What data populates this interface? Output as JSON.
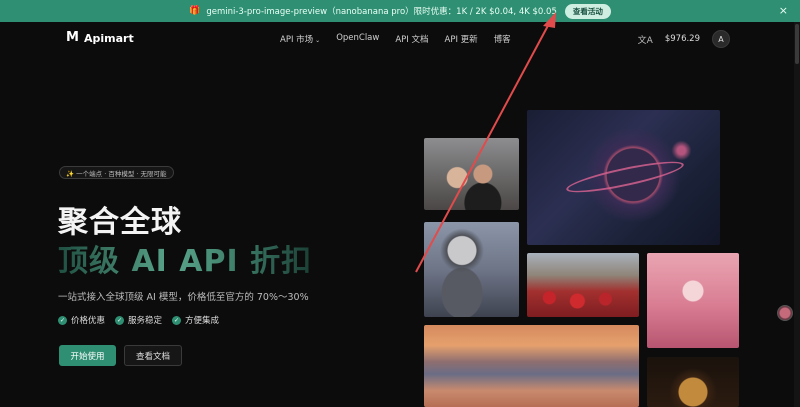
{
  "promo": {
    "icon": "gift-icon",
    "text": "gemini-3-pro-image-preview（nanobanana pro）限时优惠：1K / 2K $0.04,   4K $0.05",
    "cta": "查看活动",
    "close": "×"
  },
  "brand": {
    "name": "Apimart",
    "logo_glyph": "M"
  },
  "nav": {
    "items": [
      {
        "label": "API 市场",
        "caret": "⌄"
      },
      {
        "label": "OpenClaw"
      },
      {
        "label": "API 文档"
      },
      {
        "label": "API 更新"
      },
      {
        "label": "博客"
      }
    ]
  },
  "header_right": {
    "translate_icon": "文A",
    "balance": "$976.29",
    "avatar": "A"
  },
  "hero": {
    "badge": "✨ 一个端点 · 百种模型 · 无限可能",
    "title_line1": "聚合全球",
    "title_line2": "顶级 AI API 折扣",
    "subtitle": "一站式接入全球顶级 AI 模型，价格低至官方的 70%～30%",
    "features": [
      "价格优惠",
      "服务稳定",
      "方便集成"
    ],
    "primary_button": "开始使用",
    "secondary_button": "查看文档"
  },
  "colors": {
    "accent": "#2e8f72",
    "background": "#0c0c0c",
    "annotation_arrow": "#e24b4b"
  }
}
